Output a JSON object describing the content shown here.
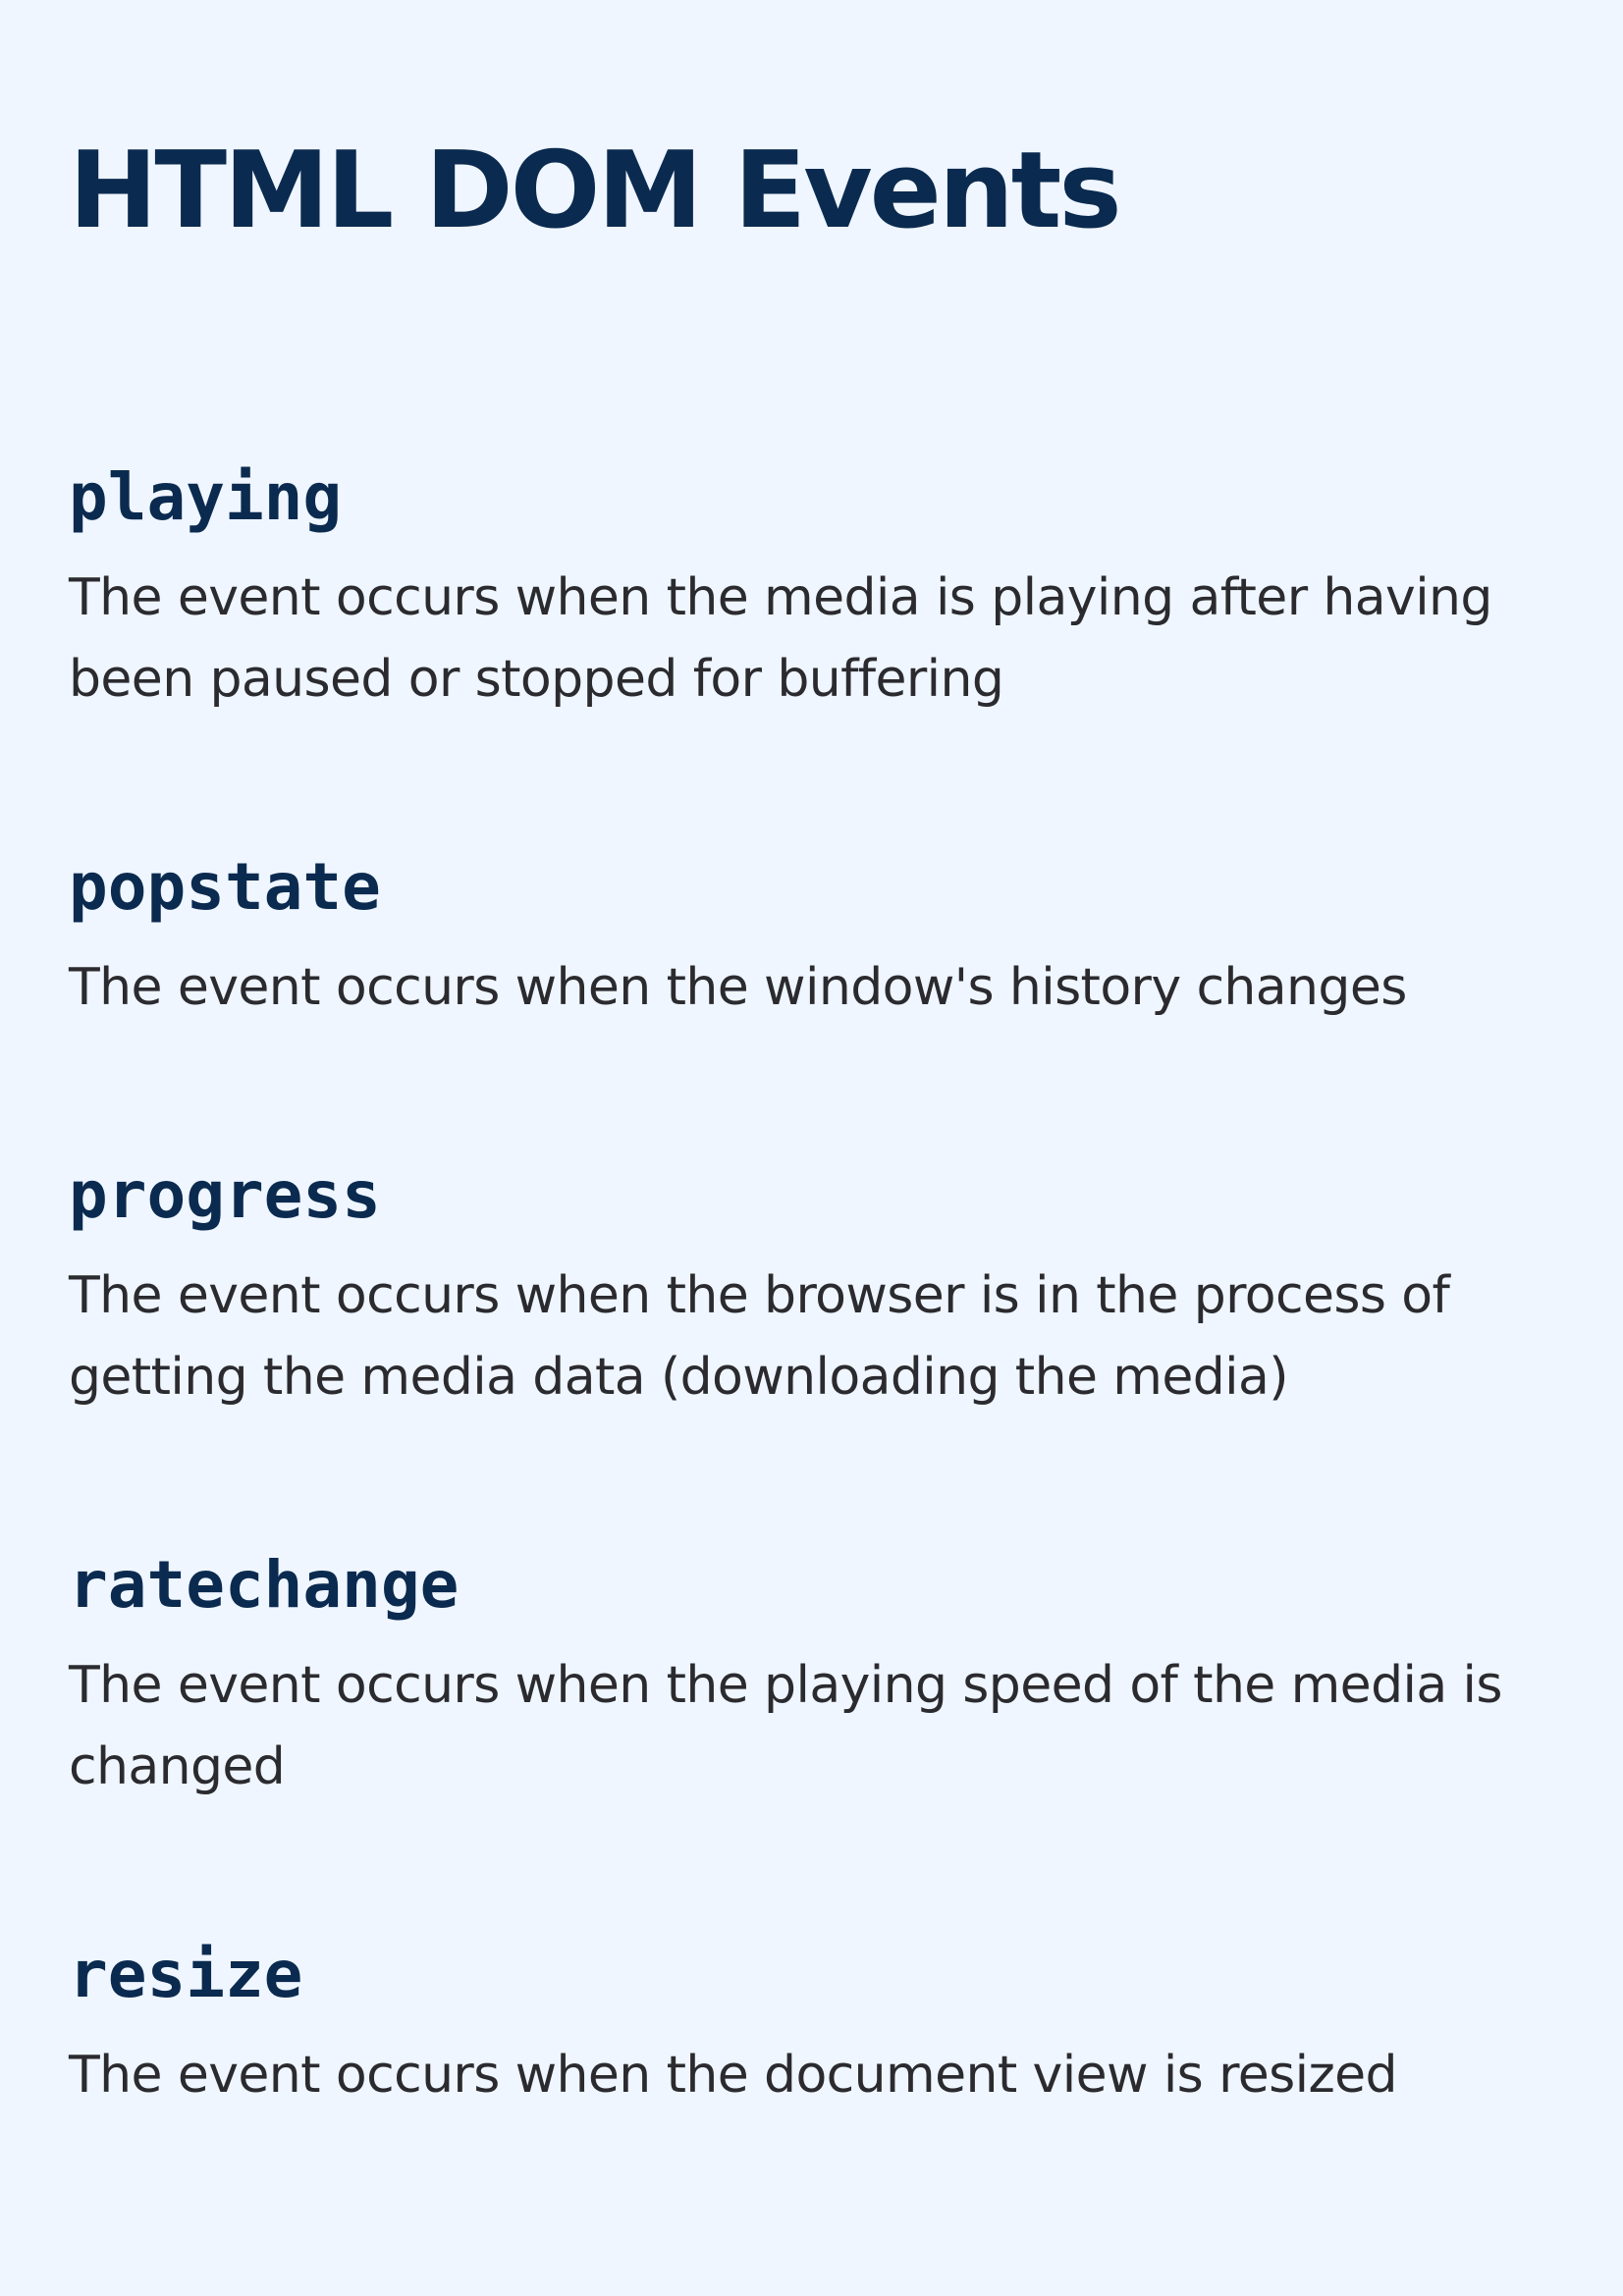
{
  "page": {
    "title": "HTML DOM Events"
  },
  "events": [
    {
      "name": "playing",
      "description": "The event occurs when the media is playing after having been paused or stopped for buffering"
    },
    {
      "name": "popstate",
      "description": "The event occurs when the window's history changes"
    },
    {
      "name": "progress",
      "description": "The event occurs when the browser is in the process of getting the media data (downloading the media)"
    },
    {
      "name": "ratechange",
      "description": "The event occurs when the playing speed of the media is changed"
    },
    {
      "name": "resize",
      "description": "The event occurs when the document view is resized"
    }
  ],
  "colors": {
    "background": "#eff6ff",
    "heading": "#0b2a4f",
    "body_text": "#2b2b2f"
  }
}
